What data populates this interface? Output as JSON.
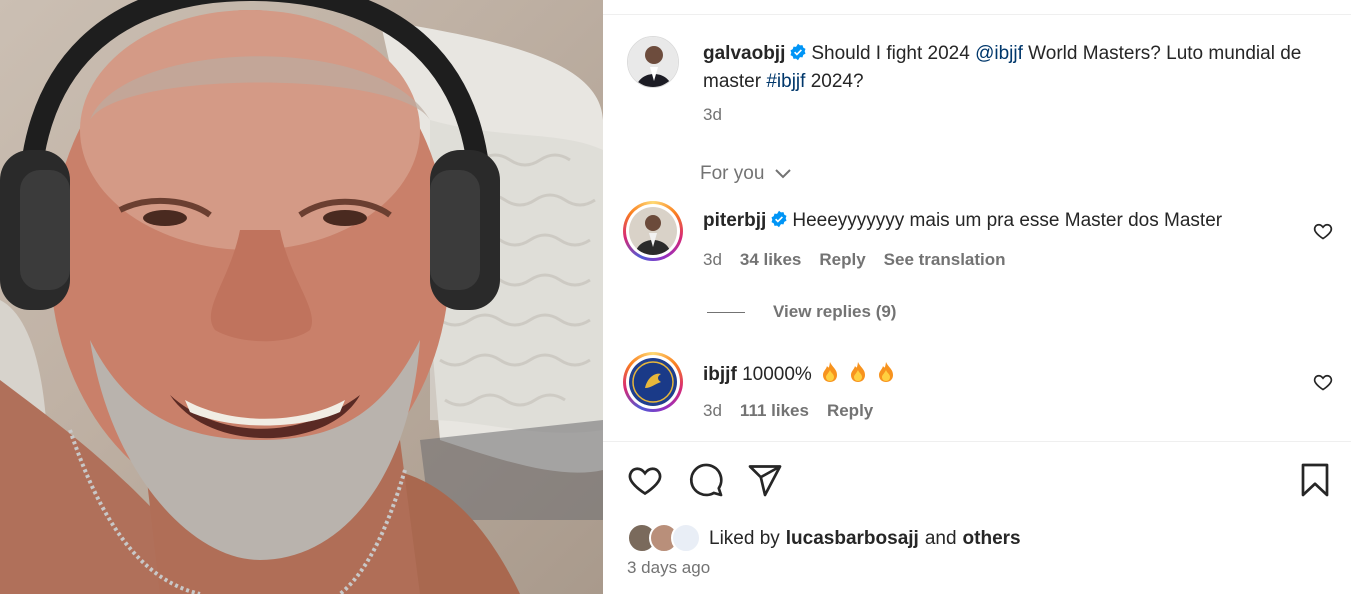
{
  "post": {
    "author": "galvaobjj",
    "caption_pre": "Should I fight 2024 ",
    "caption_mention": "@ibjjf",
    "caption_mid": " World Masters? Luto mundial de master ",
    "caption_hashtag": "#ibjjf",
    "caption_post": " 2024?",
    "time": "3d"
  },
  "sort": {
    "label": "For you"
  },
  "comments": [
    {
      "user": "piterbjj",
      "verified": true,
      "text": "Heeeyyyyyyy mais um pra esse Master dos Master",
      "time": "3d",
      "likes": "34 likes",
      "reply": "Reply",
      "translate": "See translation"
    },
    {
      "user": "ibjjf",
      "verified": false,
      "text": "10000%",
      "time": "3d",
      "likes": "111 likes",
      "reply": "Reply"
    }
  ],
  "view_replies": "View replies (9)",
  "liked_by": {
    "prefix": "Liked by",
    "user": "lucasbarbosajj",
    "connector": "and",
    "others": "others"
  },
  "posted": "3 days ago",
  "icons": [
    "verified-icon",
    "chevron-down-icon",
    "heart-icon",
    "comment-icon",
    "share-icon",
    "bookmark-icon",
    "fire-icon"
  ],
  "colors": {
    "link": "#00376b",
    "verified": "#0095f6",
    "muted": "#737373",
    "text": "#262626"
  }
}
